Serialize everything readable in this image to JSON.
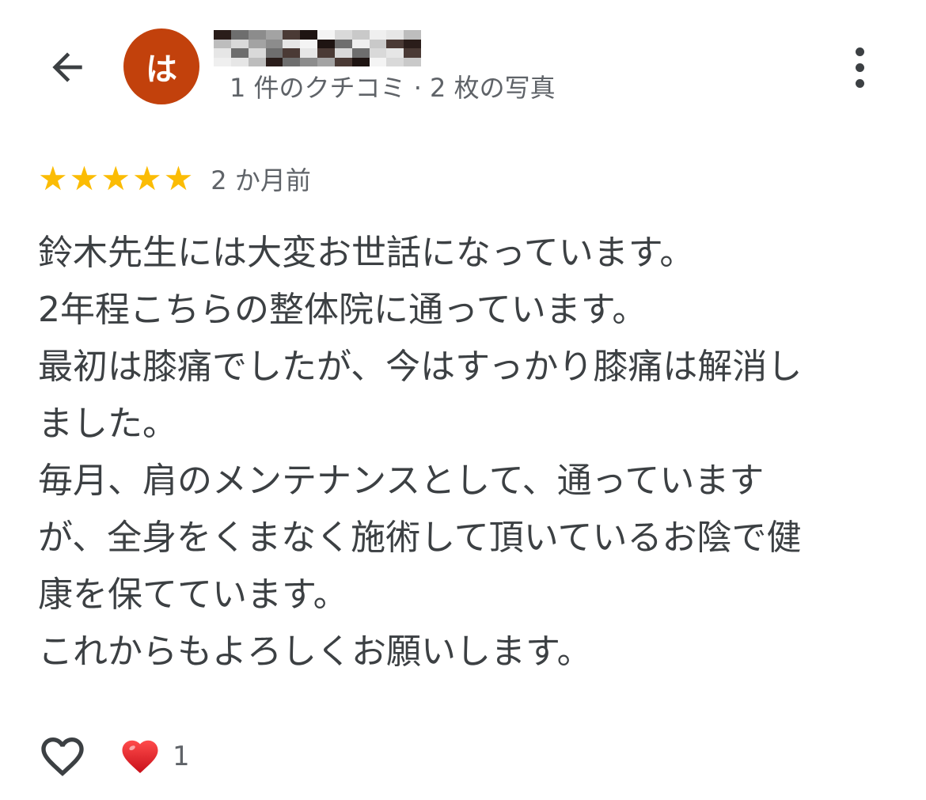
{
  "profile": {
    "avatar_initial": "は",
    "meta": "1 件のクチコミ · 2 枚の写真"
  },
  "review": {
    "stars": [
      "★",
      "★",
      "★",
      "★",
      "★"
    ],
    "rating": 5,
    "date": "2 か月前",
    "lines": [
      "鈴木先生には大変お世話になっています。",
      "2年程こちらの整体院に通っています。",
      "最初は膝痛でしたが、今はすっかり膝痛は解消し",
      "ました。",
      "毎月、肩のメンテナンスとして、通っています",
      "が、全身をくまなく施術して頂いているお陰で健",
      "康を保てています。",
      "これからもよろしくお願いします。"
    ]
  },
  "reactions": {
    "heart_count": "1"
  },
  "icons": {
    "back": "arrow-back-icon",
    "more": "more-vert-icon",
    "like": "heart-outline-icon",
    "reaction": "red-heart-icon"
  },
  "colors": {
    "avatar_bg": "#c2410c",
    "star": "#fbbc04",
    "heart": "#e0242a",
    "text": "#3c4043",
    "muted": "#5f6368"
  }
}
